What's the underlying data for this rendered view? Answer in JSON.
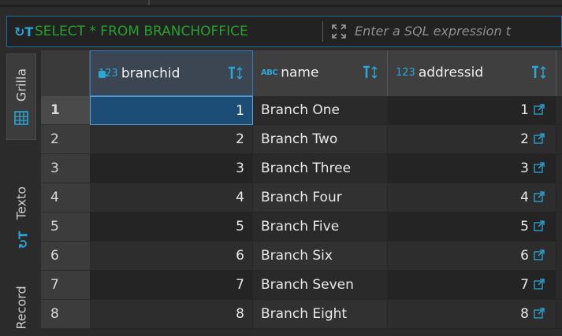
{
  "filter": {
    "sql_icon": "sql-text-icon",
    "query": "SELECT * FROM BRANCHOFFICE",
    "placeholder": "Enter a SQL expression t"
  },
  "tabs": [
    {
      "label": "Grilla",
      "icon": "grid-icon",
      "active": true
    },
    {
      "label": "Texto",
      "icon": "text-icon",
      "active": false
    },
    {
      "label": "Record",
      "icon": "record-icon",
      "active": false
    }
  ],
  "columns": [
    {
      "name": "branchid",
      "type_icon": "123",
      "key": true
    },
    {
      "name": "name",
      "type_icon": "ABC",
      "key": false
    },
    {
      "name": "addressid",
      "type_icon": "123",
      "key": false
    }
  ],
  "rows": [
    {
      "num": "1",
      "branchid": "1",
      "name": "Branch One",
      "addressid": "1"
    },
    {
      "num": "2",
      "branchid": "2",
      "name": "Branch Two",
      "addressid": "2"
    },
    {
      "num": "3",
      "branchid": "3",
      "name": "Branch Three",
      "addressid": "3"
    },
    {
      "num": "4",
      "branchid": "4",
      "name": "Branch Four",
      "addressid": "4"
    },
    {
      "num": "5",
      "branchid": "5",
      "name": "Branch Five",
      "addressid": "5"
    },
    {
      "num": "6",
      "branchid": "6",
      "name": "Branch Six",
      "addressid": "6"
    },
    {
      "num": "7",
      "branchid": "7",
      "name": "Branch Seven",
      "addressid": "7"
    },
    {
      "num": "8",
      "branchid": "8",
      "name": "Branch Eight",
      "addressid": "8"
    }
  ],
  "colors": {
    "accent": "#2aa7d8",
    "sql_text": "#25a22b",
    "selection": "#1c4d76"
  }
}
